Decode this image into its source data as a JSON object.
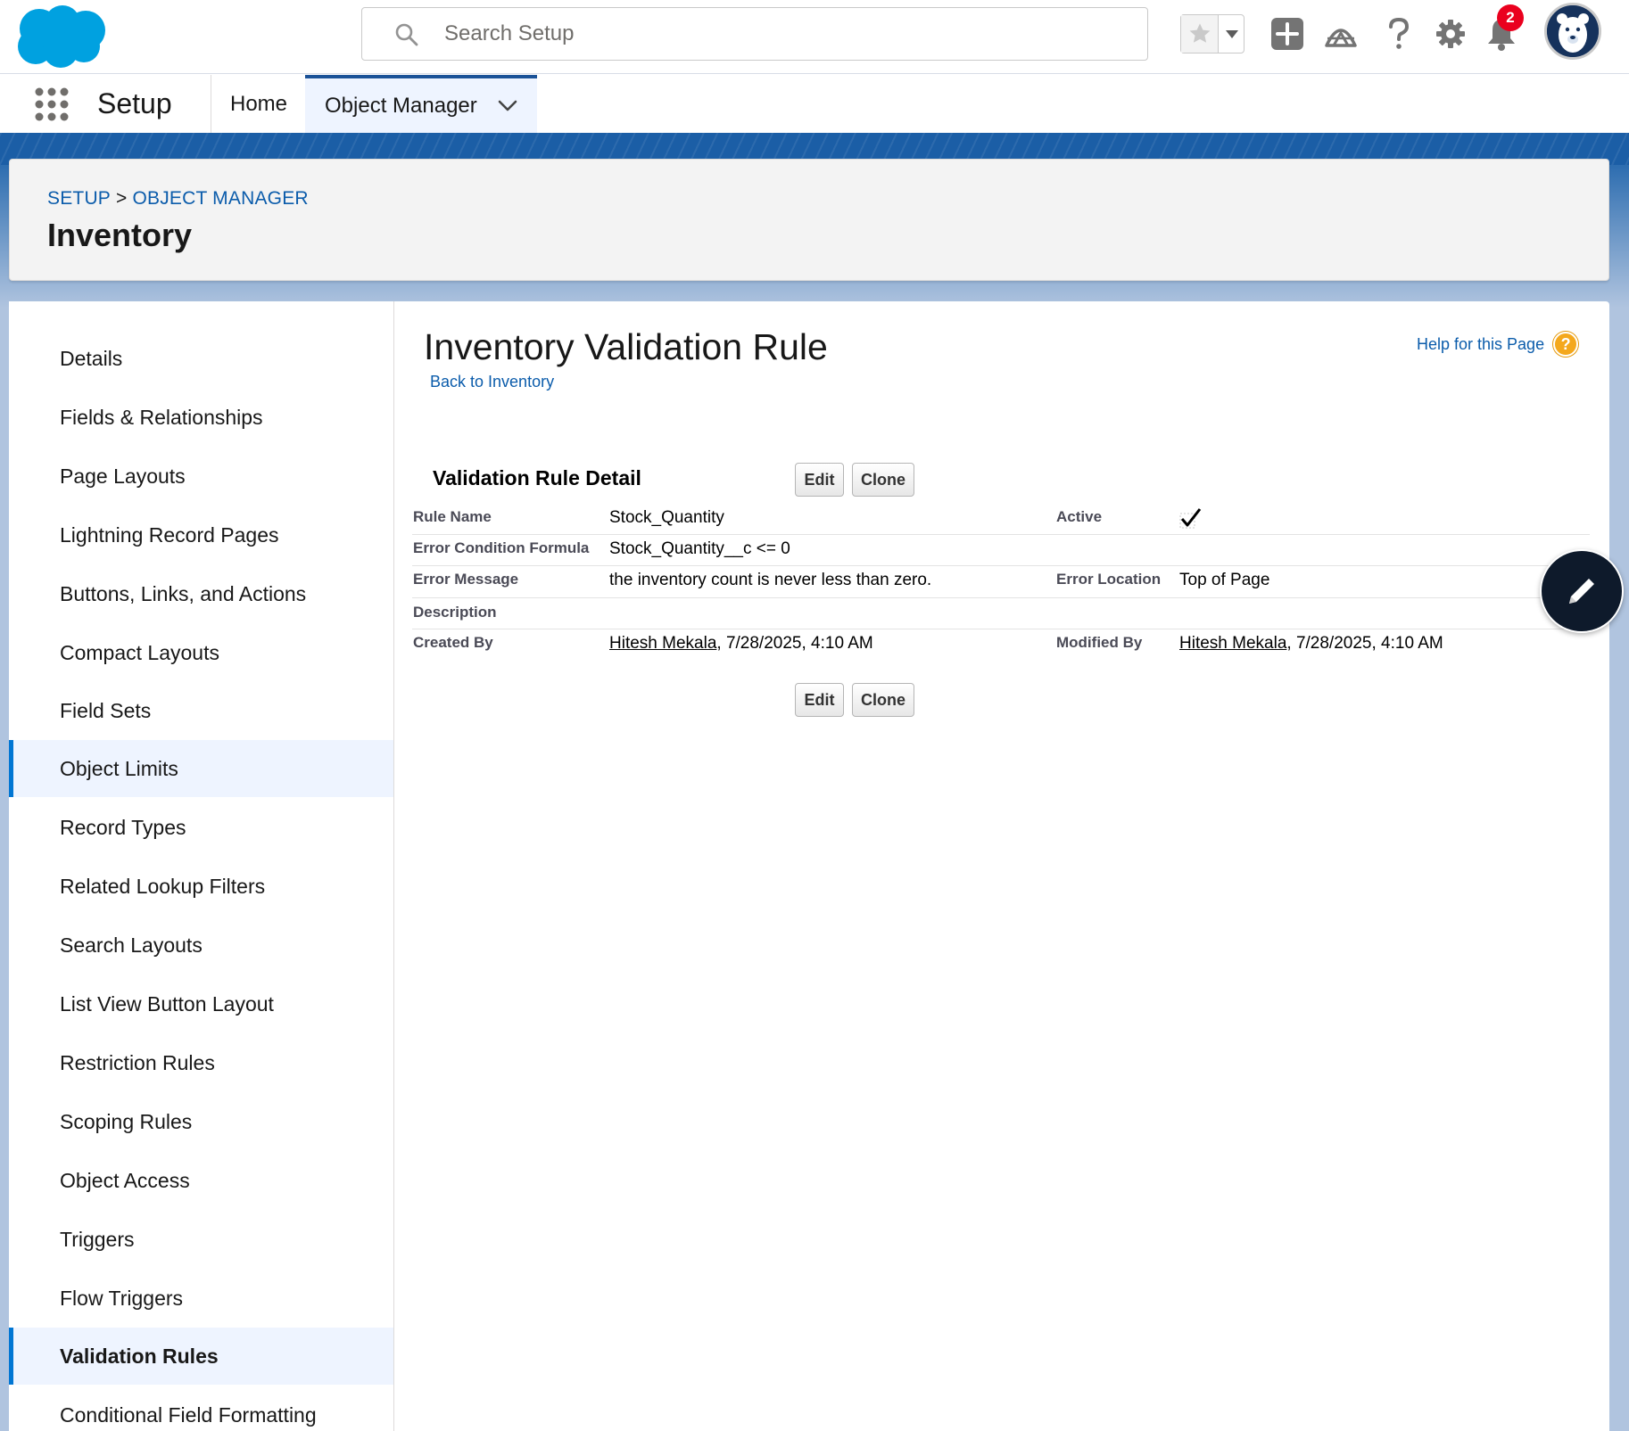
{
  "header": {
    "search_placeholder": "Search Setup",
    "notification_count": "2"
  },
  "app_nav": {
    "app_name": "Setup",
    "tabs": [
      {
        "label": "Home"
      },
      {
        "label": "Object Manager"
      }
    ]
  },
  "page_header": {
    "breadcrumb": [
      "SETUP",
      ">",
      "OBJECT MANAGER"
    ],
    "title": "Inventory"
  },
  "sidebar": {
    "items": [
      {
        "label": "Details"
      },
      {
        "label": "Fields & Relationships"
      },
      {
        "label": "Page Layouts"
      },
      {
        "label": "Lightning Record Pages"
      },
      {
        "label": "Buttons, Links, and Actions"
      },
      {
        "label": "Compact Layouts"
      },
      {
        "label": "Field Sets"
      },
      {
        "label": "Object Limits"
      },
      {
        "label": "Record Types"
      },
      {
        "label": "Related Lookup Filters"
      },
      {
        "label": "Search Layouts"
      },
      {
        "label": "List View Button Layout"
      },
      {
        "label": "Restriction Rules"
      },
      {
        "label": "Scoping Rules"
      },
      {
        "label": "Object Access"
      },
      {
        "label": "Triggers"
      },
      {
        "label": "Flow Triggers"
      },
      {
        "label": "Validation Rules"
      },
      {
        "label": "Conditional Field Formatting"
      }
    ],
    "active": "Validation Rules"
  },
  "content": {
    "title": "Inventory Validation Rule",
    "back_link": "Back to Inventory",
    "help_link": "Help for this Page",
    "help_icon_glyph": "?",
    "section_title": "Validation Rule Detail",
    "edit_label": "Edit",
    "clone_label": "Clone",
    "fields": {
      "rule_name_label": "Rule Name",
      "rule_name_value": "Stock_Quantity",
      "active_label": "Active",
      "active_value": true,
      "formula_label": "Error Condition Formula",
      "formula_value": "Stock_Quantity__c <= 0",
      "error_message_label": "Error Message",
      "error_message_value": "the inventory count is never less than zero.",
      "error_location_label": "Error Location",
      "error_location_value": "Top of Page",
      "description_label": "Description",
      "description_value": "",
      "created_by_label": "Created By",
      "created_by_user": "Hitesh Mekala",
      "created_by_date": ", 7/28/2025, 4:10 AM",
      "modified_by_label": "Modified By",
      "modified_by_user": "Hitesh Mekala",
      "modified_by_date": ", 7/28/2025, 4:10 AM"
    }
  },
  "colors": {
    "brand_blue": "#0176d3",
    "link_blue": "#0b5cab",
    "nav_active_bg": "#eef4ff",
    "notification_red": "#ea001e",
    "help_orange": "#f4a81d"
  },
  "icons": [
    "salesforce-cloud-logo",
    "search-icon",
    "star-icon",
    "chevron-down-icon",
    "add-icon",
    "trailhead-icon",
    "help-icon",
    "gear-icon",
    "bell-icon",
    "avatar",
    "app-launcher-icon",
    "checkmark-icon",
    "pencil-icon"
  ]
}
